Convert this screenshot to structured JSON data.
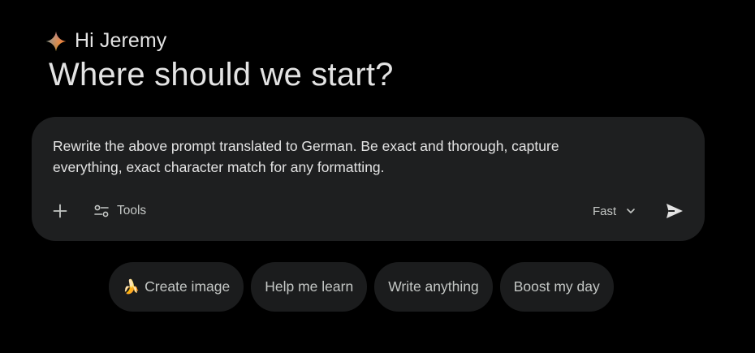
{
  "greeting": {
    "name_line": "Hi Jeremy",
    "icon": "gemini-spark-icon"
  },
  "headline": "Where should we start?",
  "composer": {
    "prompt_line1": "Rewrite the above prompt translated to German. Be exact and thorough, capture",
    "prompt_line2": "everything, exact character match for any formatting.",
    "add_icon": "plus-icon",
    "tools": {
      "icon": "sliders-icon",
      "label": "Tools"
    },
    "mode": {
      "label": "Fast",
      "icon": "chevron-down-icon"
    },
    "send_icon": "send-icon"
  },
  "chips": [
    {
      "emoji": "🍌",
      "label": "Create image"
    },
    {
      "label": "Help me learn"
    },
    {
      "label": "Write anything"
    },
    {
      "label": "Boost my day"
    }
  ],
  "colors": {
    "background": "#000000",
    "composer_bg": "#1e1f20",
    "chip_bg": "#1b1c1d",
    "text_primary": "#e3e3e3",
    "text_secondary": "#c4c7c5"
  }
}
